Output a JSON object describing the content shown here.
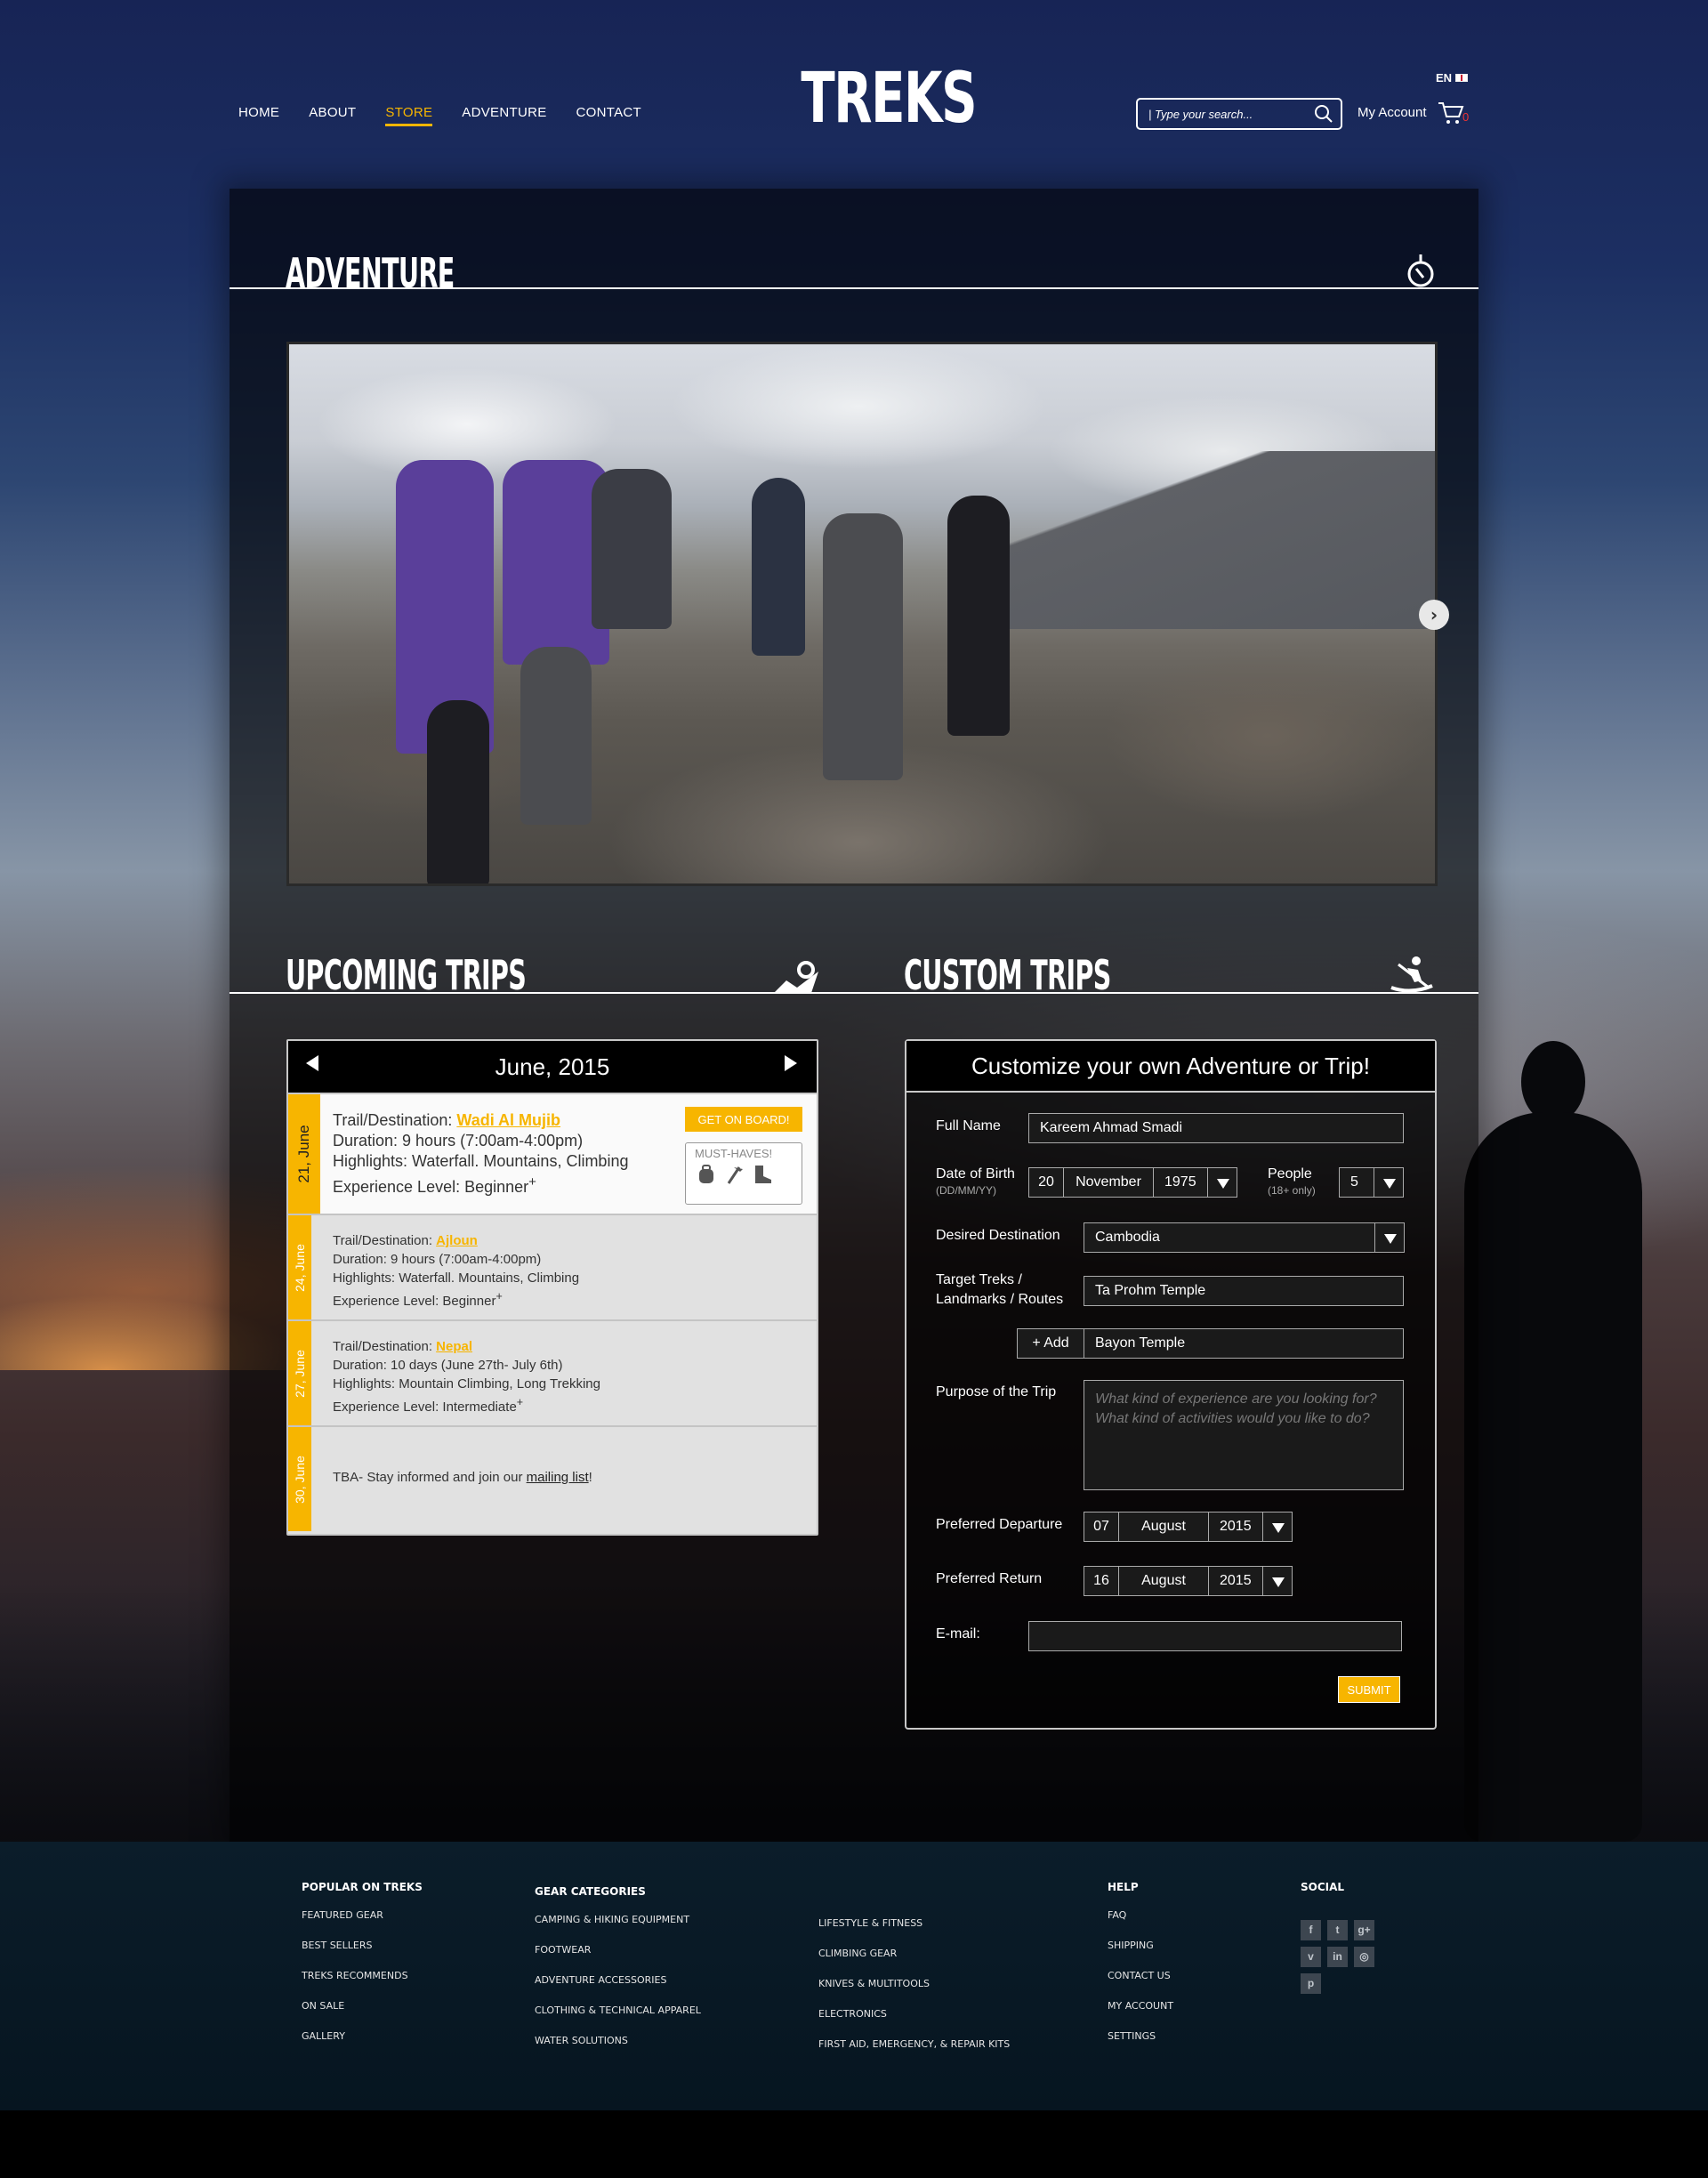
{
  "header": {
    "nav": [
      "HOME",
      "ABOUT",
      "STORE",
      "ADVENTURE",
      "CONTACT"
    ],
    "active_nav": "STORE",
    "logo": "TREKS",
    "language": "EN",
    "search_placeholder": "| Type your search...",
    "account_label": "My Account",
    "cart_count": "0"
  },
  "sections": {
    "adventure": "ADVENTURE",
    "upcoming": "UPCOMING TRIPS",
    "custom": "CUSTOM TRIPS"
  },
  "calendar": {
    "month": "June, 2015",
    "trips": [
      {
        "date": "21, June",
        "label": "Trail/Destination: ",
        "destination": "Wadi Al Mujib",
        "duration": "Duration: 9 hours (7:00am-4:00pm)",
        "highlights": "Highlights: Waterfall. Mountains, Climbing",
        "level": "Experience Level: Beginner",
        "level_mark": "+"
      },
      {
        "date": "24, June",
        "label": "Trail/Destination: ",
        "destination": "Ajloun",
        "duration": "Duration: 9 hours (7:00am-4:00pm)",
        "highlights": "Highlights: Waterfall. Mountains, Climbing",
        "level": "Experience Level: Beginner",
        "level_mark": "+"
      },
      {
        "date": "27, June",
        "label": "Trail/Destination: ",
        "destination": "Nepal",
        "duration": "Duration: 10 days (June 27th- July 6th)",
        "highlights": "Highlights: Mountain Climbing, Long Trekking",
        "level": "Experience Level: Intermediate",
        "level_mark": "+"
      },
      {
        "date": "30, June",
        "tba": "TBA- Stay informed and join our ",
        "link": "mailing list",
        "tail": "!"
      }
    ],
    "board_button": "GET ON BOARD!",
    "musthaves": "MUST-HAVES!"
  },
  "form": {
    "title": "Customize your own Adventure or Trip!",
    "full_name_label": "Full Name",
    "full_name": "Kareem Ahmad Smadi",
    "dob_label": "Date of Birth",
    "dob_hint": "(DD/MM/YY)",
    "dob_day": "20",
    "dob_month": "November",
    "dob_year": "1975",
    "people_label": "People",
    "people_hint": "(18+ only)",
    "people": "5",
    "destination_label": "Desired Destination",
    "destination": "Cambodia",
    "targets_label_1": "Target Treks /",
    "targets_label_2": "Landmarks / Routes",
    "target_1": "Ta Prohm Temple",
    "target_2": "Bayon Temple",
    "add_label": "+ Add",
    "purpose_label": "Purpose of the Trip",
    "purpose_placeholder": "What kind of experience are you looking for? What kind of activities would you like to do?",
    "departure_label": "Preferred Departure",
    "departure_day": "07",
    "departure_month": "August",
    "departure_year": "2015",
    "return_label": "Preferred Return",
    "return_day": "16",
    "return_month": "August",
    "return_year": "2015",
    "email_label": "E-mail:",
    "submit": "SUBMIT"
  },
  "footer": {
    "popular": {
      "title": "POPULAR ON TREKS",
      "items": [
        "FEATURED GEAR",
        "BEST SELLERS",
        "TREKS RECOMMENDS",
        "ON SALE",
        "GALLERY"
      ]
    },
    "gear": {
      "title": "GEAR CATEGORIES",
      "items": [
        "CAMPING & HIKING EQUIPMENT",
        "FOOTWEAR",
        "ADVENTURE ACCESSORIES",
        "CLOTHING & TECHNICAL APPAREL",
        "WATER SOLUTIONS"
      ]
    },
    "gear2": {
      "items": [
        "LIFESTYLE & FITNESS",
        "CLIMBING GEAR",
        "KNIVES & MULTITOOLS",
        "ELECTRONICS",
        "FIRST AID, EMERGENCY, & REPAIR KITS"
      ]
    },
    "help": {
      "title": "HELP",
      "items": [
        "FAQ",
        "SHIPPING",
        "CONTACT US",
        "MY ACCOUNT",
        "SETTINGS"
      ]
    },
    "social": {
      "title": "SOCIAL",
      "icons": [
        "f",
        "t",
        "g+",
        "v",
        "in",
        "◎",
        "p"
      ]
    }
  },
  "colors": {
    "accent": "#f7b500",
    "panel": "#000000",
    "footer": "#0b1d2a"
  }
}
